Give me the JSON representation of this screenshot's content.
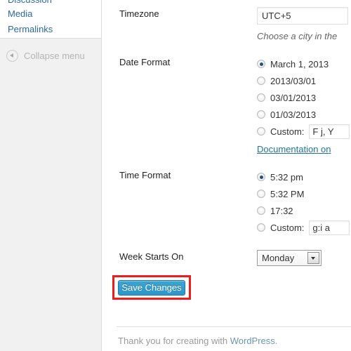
{
  "sidebar": {
    "items": [
      {
        "label": "Discussion"
      },
      {
        "label": "Media"
      },
      {
        "label": "Permalinks"
      }
    ],
    "collapse": {
      "label": "Collapse menu",
      "icon": "collapse-left-triangle-icon"
    }
  },
  "settings": {
    "timezone": {
      "label": "Timezone",
      "value": "UTC+5",
      "help": "Choose a city in the"
    },
    "date_format": {
      "label": "Date Format",
      "options": [
        {
          "label": "March 1, 2013",
          "selected": true
        },
        {
          "label": "2013/03/01",
          "selected": false
        },
        {
          "label": "03/01/2013",
          "selected": false
        },
        {
          "label": "01/03/2013",
          "selected": false
        }
      ],
      "custom_label": "Custom:",
      "custom_value": "F j, Y",
      "custom_selected": false,
      "doc_link": "Documentation on"
    },
    "time_format": {
      "label": "Time Format",
      "options": [
        {
          "label": "5:32 pm",
          "selected": true
        },
        {
          "label": "5:32 PM",
          "selected": false
        },
        {
          "label": "17:32",
          "selected": false
        }
      ],
      "custom_label": "Custom:",
      "custom_value": "g:i a",
      "custom_selected": false
    },
    "week_starts_on": {
      "label": "Week Starts On",
      "value": "Monday"
    }
  },
  "submit": {
    "save_label": "Save Changes",
    "highlight_color": "#ef1c1c",
    "button_color": "#2e96c8"
  },
  "footer": {
    "text_before": "Thank you for creating with ",
    "link": "WordPress",
    "text_after": "."
  }
}
